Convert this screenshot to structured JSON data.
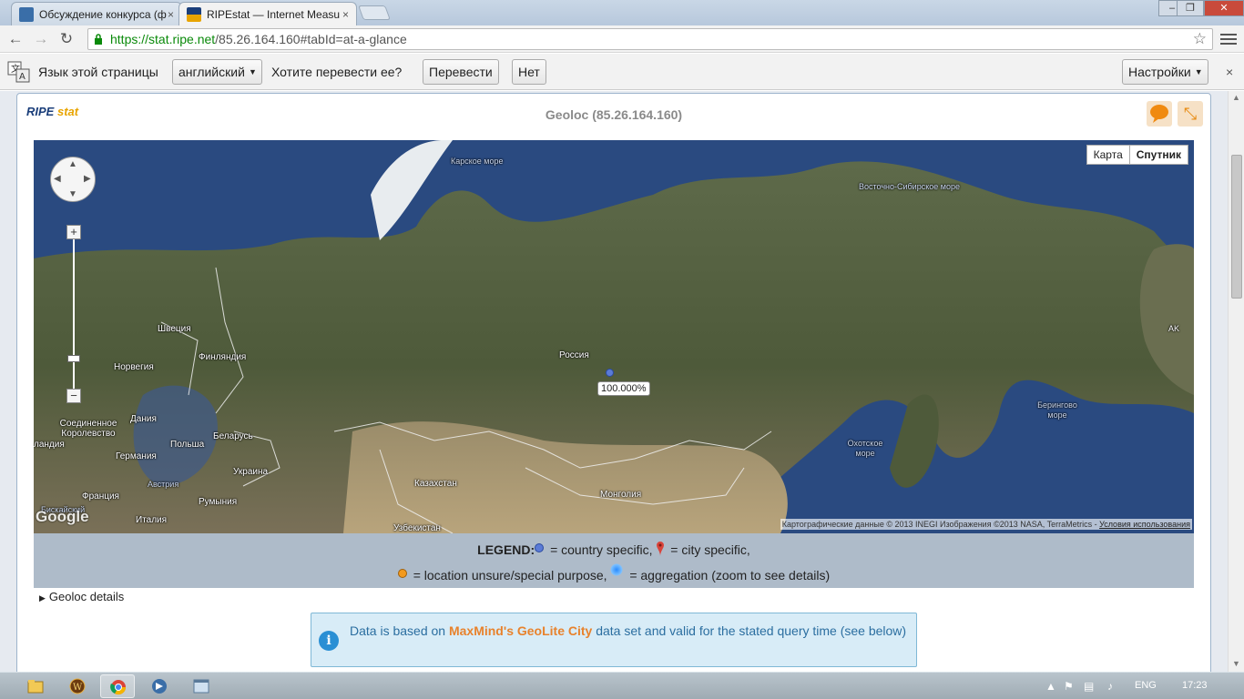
{
  "browser": {
    "tabs": [
      {
        "title": "Обсуждение конкурса (ф",
        "active": false
      },
      {
        "title": "RIPEstat — Internet Measu",
        "active": true
      }
    ],
    "close_glyph": "×",
    "url_secure": "https://stat.ripe.net",
    "url_rest": "/85.26.164.160#tabId=at-a-glance"
  },
  "translate_bar": {
    "language_prompt": "Язык этой страницы",
    "language": "английский",
    "question": "Хотите перевести ее?",
    "translate_button": "Перевести",
    "no_button": "Нет",
    "settings_button": "Настройки"
  },
  "widget": {
    "logo_ripe": "RIPE",
    "logo_stat": "stat",
    "title": "Geoloc (85.26.164.160)"
  },
  "map": {
    "type_buttons": [
      "Карта",
      "Спутник"
    ],
    "selected_type": "Спутник",
    "labels": {
      "kara_sea": "Карское море",
      "east_siberian_sea": "Восточно-Сибирское море",
      "sweden": "Швеция",
      "finland": "Финляндия",
      "norway": "Норвегия",
      "russia": "Россия",
      "denmark": "Дания",
      "uk": "Соединенное Королевство",
      "ireland": "ландия",
      "poland": "Польша",
      "belarus": "Беларусь",
      "germany": "Германия",
      "ukraine": "Украина",
      "austria": "Австрия",
      "france": "Франция",
      "romania": "Румыния",
      "italy": "Италия",
      "biscay": "Бискайский",
      "kazakhstan": "Казахстан",
      "mongolia": "Монголия",
      "uzbekistan": "Узбекистан",
      "okhotsk_sea": "Охотское море",
      "bering_sea": "Берингово море",
      "alaska": "AK"
    },
    "marker_percentage": "100.000%",
    "google_logo": "Google",
    "copyright": "Картографические данные © 2013 INEGI Изображения ©2013 NASA, TerraMetrics -",
    "terms_link": "Условия использования"
  },
  "legend": {
    "label": "LEGEND:",
    "country": "= country specific,",
    "city": "= city specific,",
    "unsure": "= location unsure/special purpose,",
    "aggregation": "= aggregation (zoom to see details)"
  },
  "details": {
    "toggle_label": "Geoloc details"
  },
  "info_box": {
    "prefix": "Data is based on ",
    "link": "MaxMind's GeoLite City",
    "suffix": " data set and valid for the stated query time (see below)"
  },
  "taskbar": {
    "language": "ENG",
    "time": "17:23"
  },
  "colors": {
    "ripe_blue": "#1a3e7a",
    "ripe_orange": "#e8a400",
    "country_dot": "#5b7bd6",
    "unsure_dot": "#f39a1e",
    "secure_url": "#0a8a0a",
    "info_link": "#e8822c"
  }
}
